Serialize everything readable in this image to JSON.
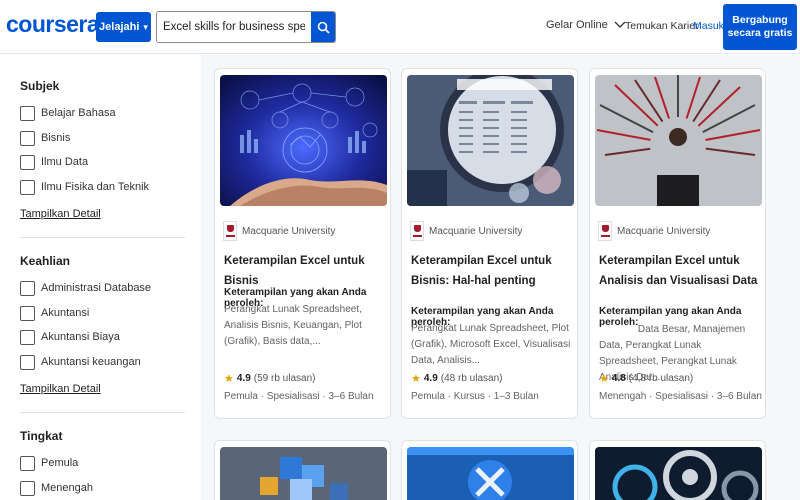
{
  "header": {
    "logo": "coursera",
    "explore_label": "Jelajahi",
    "search_value": "Excel skills for business specializatic",
    "nav_degrees": "Gelar Online",
    "nav_careers": "Temukan Karier",
    "nav_login": "Masuk",
    "join_label": "Bergabung secara gratis",
    "accent_color": "#0056d2"
  },
  "sidebar": {
    "sections": [
      {
        "title": "Subjek",
        "options": [
          "Belajar Bahasa",
          "Bisnis",
          "Ilmu Data",
          "Ilmu Fisika dan Teknik"
        ],
        "show_more": "Tampilkan Detail"
      },
      {
        "title": "Keahlian",
        "options": [
          "Administrasi Database",
          "Akuntansi",
          "Akuntansi Biaya",
          "Akuntansi keuangan"
        ],
        "show_more": "Tampilkan Detail"
      },
      {
        "title": "Tingkat",
        "options": [
          "Pemula",
          "Menengah"
        ]
      }
    ]
  },
  "cards": [
    {
      "partner": "Macquarie University",
      "title": "Keterampilan Excel untuk Bisnis",
      "skills_heading": "Keterampilan yang akan Anda peroleh:",
      "skills": "Perangkat Lunak Spreadsheet, Analisis Bisnis, Keuangan, Plot (Grafik), Basis data,...",
      "rating": "4.9",
      "reviews": "(59 rb ulasan)",
      "meta": "Pemula · Spesialisasi · 3–6 Bulan",
      "image_icon": "data-hand-image"
    },
    {
      "partner": "Macquarie University",
      "title": "Keterampilan Excel untuk Bisnis: Hal-hal penting",
      "skills_heading": "Keterampilan yang akan Anda peroleh:",
      "skills": "Perangkat Lunak Spreadsheet, Plot (Grafik), Microsoft Excel, Visualisasi Data, Analisis...",
      "rating": "4.9",
      "reviews": "(48 rb ulasan)",
      "meta": "Pemula · Kursus · 1–3 Bulan",
      "image_icon": "magnifier-report-image"
    },
    {
      "partner": "Macquarie University",
      "title": "Keterampilan Excel untuk Analisis dan Visualisasi Data",
      "skills_heading": "Keterampilan yang akan Anda peroleh:",
      "skills": "Data Besar, Manajemen Data, Perangkat Lunak Spreadsheet, Perangkat Lunak Analisis Dat...",
      "rating": "4.8",
      "reviews": "(4,8 rb ulasan)",
      "meta": "Menengah · Spesialisasi · 3–6 Bulan",
      "image_icon": "radial-chart-person-image"
    }
  ]
}
